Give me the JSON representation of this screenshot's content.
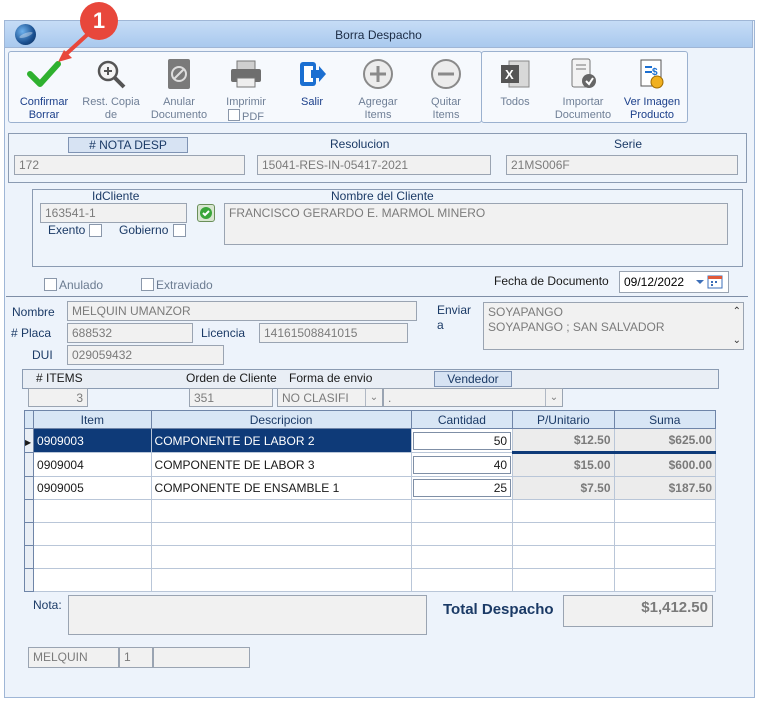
{
  "window": {
    "title": "Borra Despacho"
  },
  "callout": {
    "number": "1"
  },
  "toolbar": [
    {
      "name": "confirm-delete-button",
      "icon": "checkmark-icon",
      "line1": "Confirmar",
      "line2": "Borrar",
      "enabled": true
    },
    {
      "name": "restore-copy-button",
      "icon": "zoom-icon",
      "line1": "Rest. Copia",
      "line2": "de",
      "enabled": false
    },
    {
      "name": "void-document-button",
      "icon": "void-document-icon",
      "line1": "Anular",
      "line2": "Documento",
      "enabled": false
    },
    {
      "name": "print-button",
      "icon": "printer-icon",
      "line1": "Imprimir",
      "line2": "PDF",
      "enabled": false
    },
    {
      "name": "exit-button",
      "icon": "exit-icon",
      "line1": "Salir",
      "line2": "",
      "enabled": true
    },
    {
      "name": "add-items-button",
      "icon": "plus-circle-icon",
      "line1": "Agregar",
      "line2": "Items",
      "enabled": false
    },
    {
      "name": "remove-items-button",
      "icon": "minus-circle-icon",
      "line1": "Quitar",
      "line2": "Items",
      "enabled": false
    }
  ],
  "toolbar2": [
    {
      "name": "export-all-button",
      "icon": "excel-icon",
      "line1": "Todos",
      "line2": "",
      "enabled": false
    },
    {
      "name": "import-document-button",
      "icon": "import-document-icon",
      "line1": "Importar",
      "line2": "Documento",
      "enabled": false
    },
    {
      "name": "view-product-image-button",
      "icon": "invoice-icon",
      "line1": "Ver Imagen",
      "line2": "Producto",
      "enabled": true
    }
  ],
  "doc": {
    "nota_label": "# NOTA DESP",
    "nota_value": "172",
    "resolucion_label": "Resolucion",
    "resolucion_value": "15041-RES-IN-05417-2021",
    "serie_label": "Serie",
    "serie_value": "21MS006F"
  },
  "client": {
    "id_label": "IdCliente",
    "id_value": "163541-1",
    "name_label": "Nombre del Cliente",
    "name_value": "FRANCISCO GERARDO E. MARMOL MINERO",
    "exento_label": "Exento",
    "gobierno_label": "Gobierno"
  },
  "flags": {
    "anulado_label": "Anulado",
    "extraviado_label": "Extraviado"
  },
  "fecha": {
    "label": "Fecha de Documento",
    "value": "09/12/2022"
  },
  "driver": {
    "nombre_label": "Nombre",
    "nombre_value": "MELQUIN UMANZOR",
    "placa_label": "# Placa",
    "placa_value": "688532",
    "licencia_label": "Licencia",
    "licencia_value": "14161508841015",
    "dui_label": "DUI",
    "dui_value": "029059432",
    "enviar_label_1": "Enviar",
    "enviar_label_2": "a",
    "enviar_line1": "SOYAPANGO",
    "enviar_line2": "SOYAPANGO ; SAN SALVADOR"
  },
  "summary": {
    "items_label": "# ITEMS",
    "items_value": "3",
    "orden_label": "Orden de Cliente",
    "orden_value": "351",
    "forma_label": "Forma de envio",
    "forma_value": "NO CLASIFI",
    "vendedor_label": "Vendedor",
    "vendedor_value": "."
  },
  "grid": {
    "headers": [
      "Item",
      "Descripcion",
      "Cantidad",
      "P/Unitario",
      "Suma"
    ],
    "rows": [
      {
        "item": "0909003",
        "desc": "COMPONENTE DE LABOR 2",
        "qty": "50",
        "price": "$12.50",
        "sum": "$625.00"
      },
      {
        "item": "0909004",
        "desc": "COMPONENTE DE LABOR 3",
        "qty": "40",
        "price": "$15.00",
        "sum": "$600.00"
      },
      {
        "item": "0909005",
        "desc": "COMPONENTE DE ENSAMBLE 1",
        "qty": "25",
        "price": "$7.50",
        "sum": "$187.50"
      }
    ]
  },
  "footer": {
    "nota_label": "Nota:",
    "nota_value": "",
    "total_label": "Total Despacho",
    "total_value": "$1,412.50",
    "user": "MELQUIN",
    "count": "1",
    "extra": ""
  }
}
